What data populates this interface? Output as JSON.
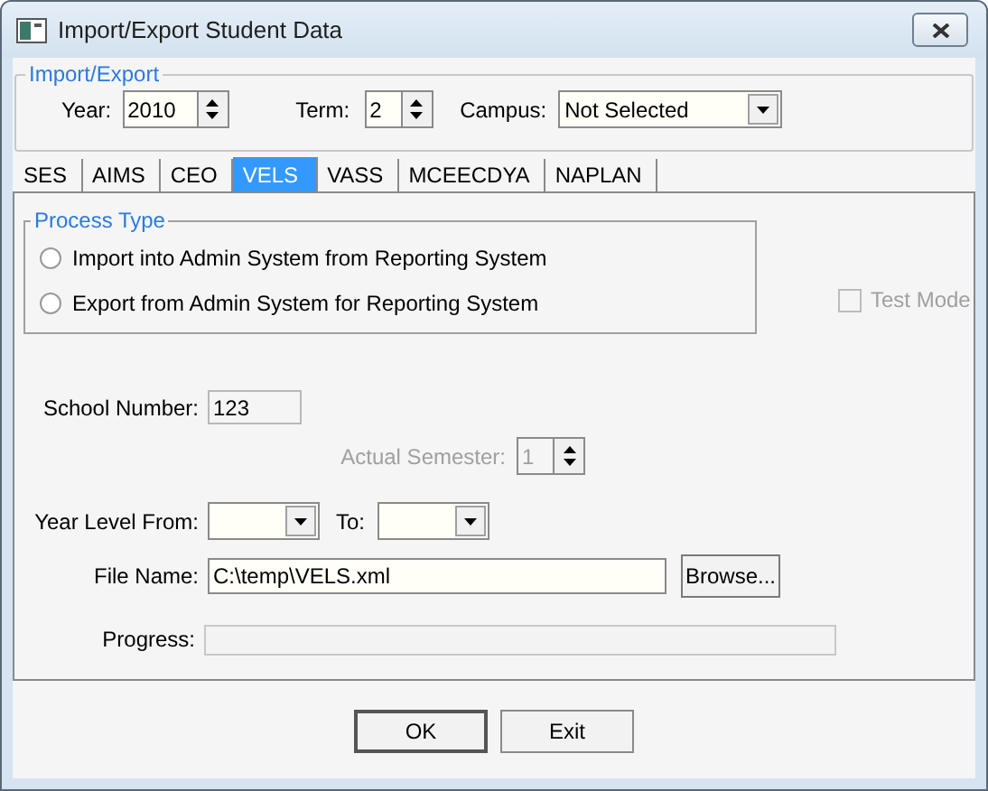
{
  "window": {
    "title": "Import/Export Student Data"
  },
  "import_export": {
    "title": "Import/Export",
    "year": {
      "label": "Year:",
      "value": "2010"
    },
    "term": {
      "label": "Term:",
      "value": "2"
    },
    "campus": {
      "label": "Campus:",
      "value": "Not Selected"
    }
  },
  "tabs": [
    {
      "label": "SES",
      "selected": false
    },
    {
      "label": "AIMS",
      "selected": false
    },
    {
      "label": "CEO",
      "selected": false
    },
    {
      "label": "VELS",
      "selected": true
    },
    {
      "label": "VASS",
      "selected": false
    },
    {
      "label": "MCEECDYA",
      "selected": false
    },
    {
      "label": "NAPLAN",
      "selected": false
    }
  ],
  "process_type": {
    "title": "Process Type",
    "options": [
      {
        "label": "Import into Admin System from Reporting System",
        "selected": false
      },
      {
        "label": "Export from Admin System for Reporting System",
        "selected": false
      }
    ]
  },
  "test_mode": {
    "label": "Test Mode",
    "checked": false,
    "disabled": true
  },
  "school_number": {
    "label": "School Number:",
    "value": "123"
  },
  "actual_semester": {
    "label": "Actual Semester:",
    "value": "1",
    "disabled": true
  },
  "year_level": {
    "label_from": "Year Level From:",
    "label_to": "To:"
  },
  "file_name": {
    "label": "File Name:",
    "value": "C:\\temp\\VELS.xml",
    "browse": "Browse..."
  },
  "progress": {
    "label": "Progress:",
    "level": 0
  },
  "buttons": [
    {
      "label": "OK",
      "default": true
    },
    {
      "label": "Exit",
      "default": false
    }
  ]
}
